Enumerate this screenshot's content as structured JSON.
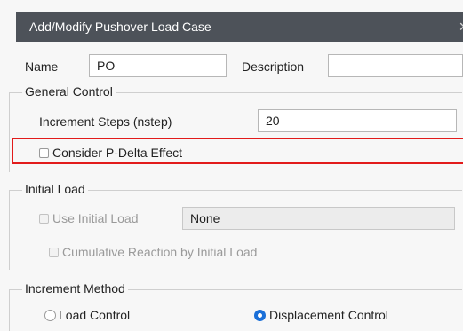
{
  "dialog": {
    "title": "Add/Modify Pushover Load Case",
    "close_glyph": "×"
  },
  "name": {
    "label": "Name",
    "value": "PO"
  },
  "description": {
    "label": "Description",
    "value": ""
  },
  "general_control": {
    "title": "General Control",
    "increment_steps_label": "Increment Steps (nstep)",
    "increment_steps_value": "20",
    "pdelta_label": "Consider P-Delta Effect",
    "pdelta_checked": false
  },
  "initial_load": {
    "title": "Initial Load",
    "use_initial_load_label": "Use Initial Load",
    "use_initial_load_value": "None",
    "cumulative_label": "Cumulative Reaction by Initial Load"
  },
  "increment_method": {
    "title": "Increment Method",
    "options": [
      "Load Control",
      "Displacement Control"
    ],
    "selected": "Displacement Control"
  },
  "colors": {
    "titlebar": "#4d5259",
    "highlight": "#e21b1b",
    "radio_selected": "#1a6fd8"
  },
  "icons": {
    "close": "close-icon"
  }
}
